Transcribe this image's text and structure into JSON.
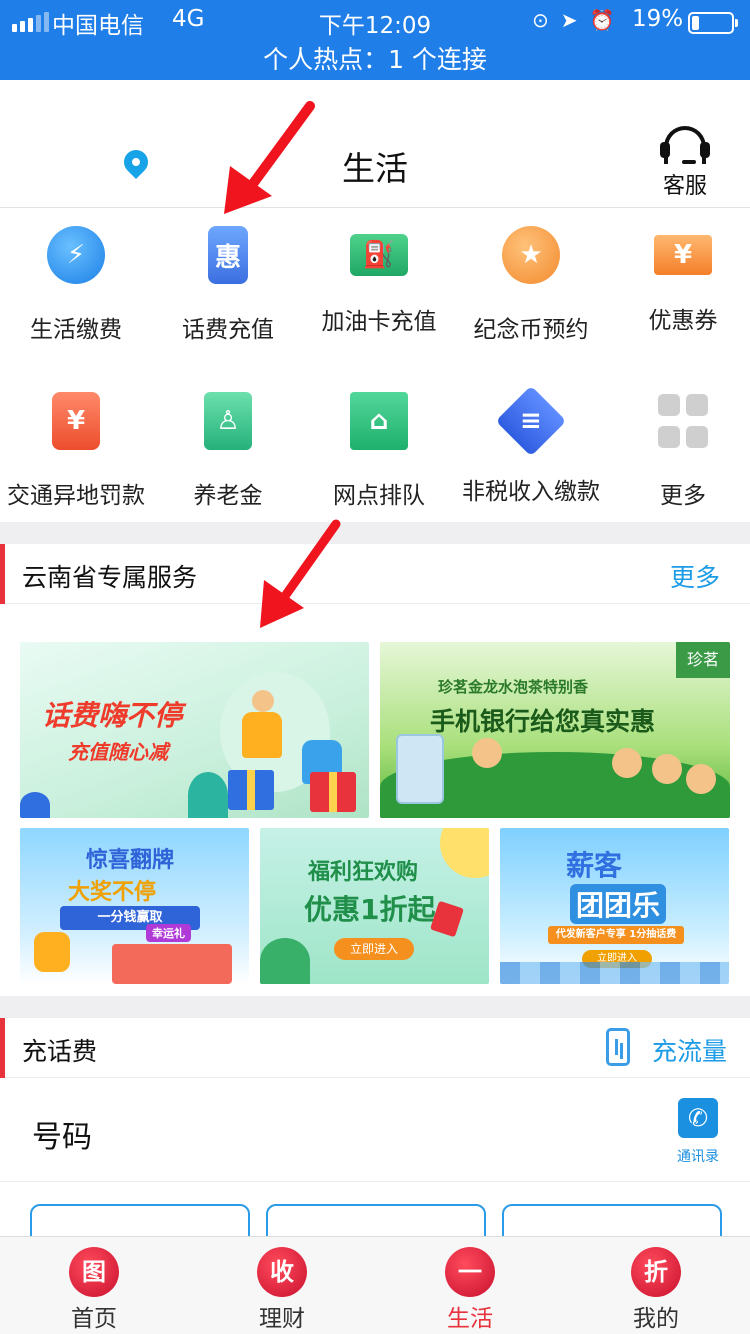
{
  "status_bar": {
    "carrier": "中国电信",
    "network": "4G",
    "time": "下午12:09",
    "battery": "19%",
    "battery_level": 0.19,
    "hotspot": "个人热点：1 个连接"
  },
  "header": {
    "title": "生活",
    "service_label": "客服"
  },
  "services": [
    {
      "label": "生活缴费",
      "icon": "lightning-icon",
      "glyph": "⚡"
    },
    {
      "label": "话费充值",
      "icon": "phone-coupon-icon",
      "glyph": "惠"
    },
    {
      "label": "加油卡充值",
      "icon": "fuel-card-icon",
      "glyph": "⛽"
    },
    {
      "label": "纪念币预约",
      "icon": "star-coin-icon",
      "glyph": "★"
    },
    {
      "label": "优惠券",
      "icon": "coupon-icon",
      "glyph": "¥"
    },
    {
      "label": "交通异地罚款",
      "icon": "traffic-light-icon",
      "glyph": "¥"
    },
    {
      "label": "养老金",
      "icon": "pension-icon",
      "glyph": "♙"
    },
    {
      "label": "网点排队",
      "icon": "bank-branch-icon",
      "glyph": "⌂"
    },
    {
      "label": "非税收入缴款",
      "icon": "tax-icon",
      "glyph": "≡"
    },
    {
      "label": "更多",
      "icon": "more-grid-icon",
      "glyph": ""
    }
  ],
  "province_section": {
    "title": "云南省专属服务",
    "more": "更多",
    "banners": [
      {
        "title": "话费嗨不停",
        "subtitle": "充值随心减"
      },
      {
        "title": "手机银行给您真实惠",
        "subtitle": "珍茗金龙水泡茶特别香",
        "tag": "珍茗"
      },
      {
        "title": "惊喜翻牌",
        "line2": "大奖不停",
        "ribbon": "一分钱赢取",
        "badge": "幸运礼"
      },
      {
        "title": "福利狂欢购",
        "subtitle": "优惠1折起",
        "button": "立即进入"
      },
      {
        "title": "薪客",
        "subtitle": "团团乐",
        "ribbon": "代发新客户专享  1分抽话费",
        "button": "立即进入"
      }
    ]
  },
  "recharge_section": {
    "title": "充话费",
    "flow_link": "充流量",
    "number_label": "号码",
    "contacts_label": "通讯录"
  },
  "tabbar": [
    {
      "label": "首页",
      "glyph": "图",
      "active": false
    },
    {
      "label": "理财",
      "glyph": "收",
      "active": false
    },
    {
      "label": "生活",
      "glyph": "一",
      "active": true
    },
    {
      "label": "我的",
      "glyph": "折",
      "active": false
    }
  ],
  "colors": {
    "status_bar": "#1f7ee8",
    "accent_red": "#e8323c",
    "link_blue": "#1c9be6",
    "annotation_red": "#f0141e"
  }
}
